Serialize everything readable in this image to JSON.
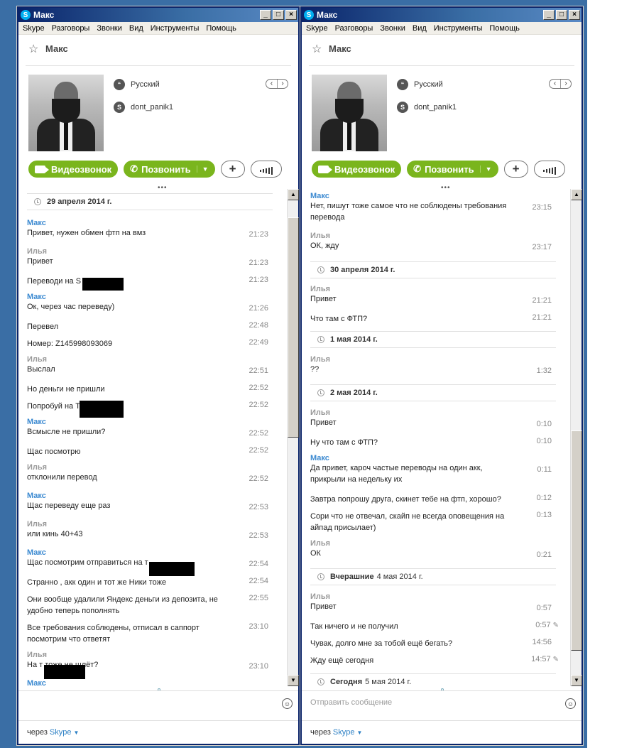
{
  "window_title": "Макс",
  "window_buttons": [
    "_",
    "□",
    "×"
  ],
  "menu": [
    "Skype",
    "Разговоры",
    "Звонки",
    "Вид",
    "Инструменты",
    "Помощь"
  ],
  "contact": {
    "name": "Макс",
    "language": "Русский",
    "skype_id": "dont_panik1"
  },
  "actions": {
    "video": "Видеозвонок",
    "call": "Позвонить",
    "add": "+"
  },
  "input_placeholder": "Отправить сообщение",
  "footer": {
    "via": "через",
    "brand": "Skype"
  },
  "left_chat": {
    "date1": {
      "bold": "29 апреля 2014 г.",
      "rest": ""
    },
    "messages": [
      {
        "sender": "Макс",
        "text": "Привет, нужен обмен фтп на вмз",
        "time": "21:23"
      },
      {
        "sender": "Илья",
        "text": "Привет",
        "time": "21:23"
      },
      {
        "sender": "",
        "text": "Переводи на S",
        "time": "21:23"
      },
      {
        "sender": "Макс",
        "text": "Ок, через час переведу)",
        "time": "21:26"
      },
      {
        "sender": "",
        "text": "Перевел",
        "time": "22:48"
      },
      {
        "sender": "",
        "text": "Номер:  Z145998093069",
        "time": "22:49"
      },
      {
        "sender": "Илья",
        "text": "Выслал",
        "time": "22:51"
      },
      {
        "sender": "",
        "text": "Но деньги не пришли",
        "time": "22:52"
      },
      {
        "sender": "",
        "text": "Попробуй на T",
        "time": "22:52"
      },
      {
        "sender": "Макс",
        "text": "Всмысле не пришли?",
        "time": "22:52"
      },
      {
        "sender": "",
        "text": "Щас посмотрю",
        "time": "22:52"
      },
      {
        "sender": "Илья",
        "text": "отклонили перевод",
        "time": "22:52"
      },
      {
        "sender": "Макс",
        "text": "Щас переведу еще раз",
        "time": "22:53"
      },
      {
        "sender": "Илья",
        "text": "или кинь 40+43",
        "time": "22:53"
      },
      {
        "sender": "Макс",
        "text": "Щас посмотрим отправиться на т",
        "time": "22:54"
      },
      {
        "sender": "",
        "text": "Странно , акк один и тот же Ники тоже",
        "time": "22:54"
      },
      {
        "sender": "",
        "text": "Они вообще удалили Яндекс деньги из депозита, не удобно теперь пополнять",
        "time": "22:55"
      },
      {
        "sender": "",
        "text": "Все требования соблюдены, отписал в саппорт посмотрим что ответят",
        "time": "23:10"
      },
      {
        "sender": "Илья",
        "text": "На т                   тоже не шлёт?",
        "time": "23:10"
      },
      {
        "sender": "Макс",
        "text": "",
        "time": ""
      }
    ]
  },
  "right_chat": {
    "messages_a": [
      {
        "sender": "Макс",
        "text": "Нет, пишут тоже самое что не соблюдены требования перевода",
        "time": "23:15"
      },
      {
        "sender": "Илья",
        "text": "ОК, жду",
        "time": "23:17"
      }
    ],
    "date2": {
      "bold": "30 апреля 2014 г.",
      "rest": ""
    },
    "messages_b": [
      {
        "sender": "Илья",
        "text": "Привет",
        "time": "21:21"
      },
      {
        "sender": "",
        "text": "Что там с ФТП?",
        "time": "21:21"
      }
    ],
    "date3": {
      "bold": "1 мая 2014 г.",
      "rest": ""
    },
    "messages_c": [
      {
        "sender": "Илья",
        "text": "??",
        "time": "1:32"
      }
    ],
    "date4": {
      "bold": "2 мая 2014 г.",
      "rest": ""
    },
    "messages_d": [
      {
        "sender": "Илья",
        "text": "Привет",
        "time": "0:10"
      },
      {
        "sender": "",
        "text": "Ну что там с ФТП?",
        "time": "0:10"
      },
      {
        "sender": "Макс",
        "text": "Да привет, кароч частые переводы на один акк, прикрыли на недельку их",
        "time": "0:11"
      },
      {
        "sender": "",
        "text": "Завтра попрошу друга, скинет тебе на фтп, хорошо?",
        "time": "0:12"
      },
      {
        "sender": "",
        "text": "Сори что не отвечал, скайп не всегда оповещения на айпад присылает)",
        "time": "0:13"
      },
      {
        "sender": "Илья",
        "text": "ОК",
        "time": "0:21"
      }
    ],
    "date5": {
      "bold": "Вчерашние",
      "rest": "4 мая 2014 г."
    },
    "messages_e": [
      {
        "sender": "Илья",
        "text": "Привет",
        "time": "0:57"
      },
      {
        "sender": "",
        "text": "Так ничего и не получил",
        "time": "0:57"
      },
      {
        "sender": "",
        "text": "Чувак, долго мне за тобой ещё бегать?",
        "time": "14:56"
      },
      {
        "sender": "",
        "text": "Жду ещё сегодня",
        "time": "14:57"
      }
    ],
    "date6": {
      "bold": "Сегодня",
      "rest": "5 мая 2014 г."
    }
  }
}
